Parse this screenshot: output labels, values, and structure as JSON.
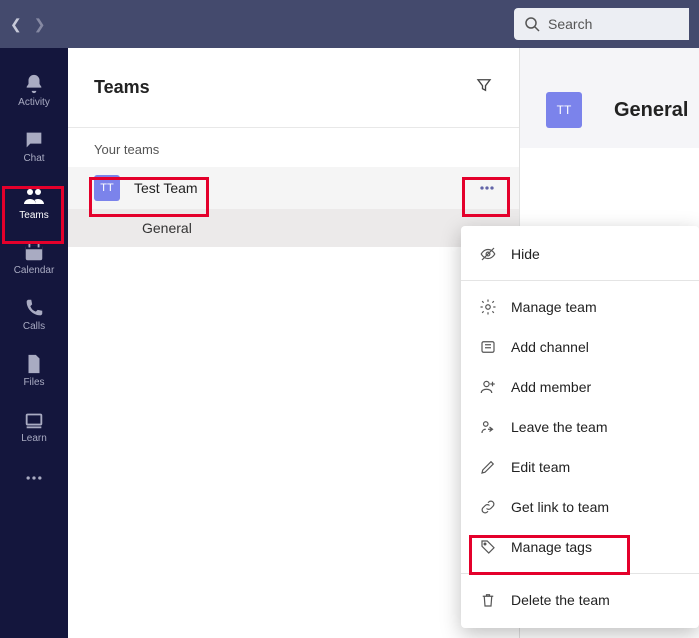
{
  "topbar": {
    "search_placeholder": "Search"
  },
  "rail": {
    "items": [
      {
        "label": "Activity"
      },
      {
        "label": "Chat"
      },
      {
        "label": "Teams"
      },
      {
        "label": "Calendar"
      },
      {
        "label": "Calls"
      },
      {
        "label": "Files"
      },
      {
        "label": "Learn"
      }
    ]
  },
  "teams_panel": {
    "title": "Teams",
    "section_label": "Your teams",
    "team": {
      "initials": "TT",
      "name": "Test Team",
      "channel": "General"
    }
  },
  "channel_header": {
    "initials": "TT",
    "name": "General"
  },
  "context_menu": {
    "hide": "Hide",
    "manage_team": "Manage team",
    "add_channel": "Add channel",
    "add_member": "Add member",
    "leave_team": "Leave the team",
    "edit_team": "Edit team",
    "get_link": "Get link to team",
    "manage_tags": "Manage tags",
    "delete_team": "Delete the team"
  },
  "colors": {
    "accent": "#7b83eb",
    "topbar": "#444a6d",
    "rail": "#14163d",
    "highlight": "#e4002b"
  }
}
